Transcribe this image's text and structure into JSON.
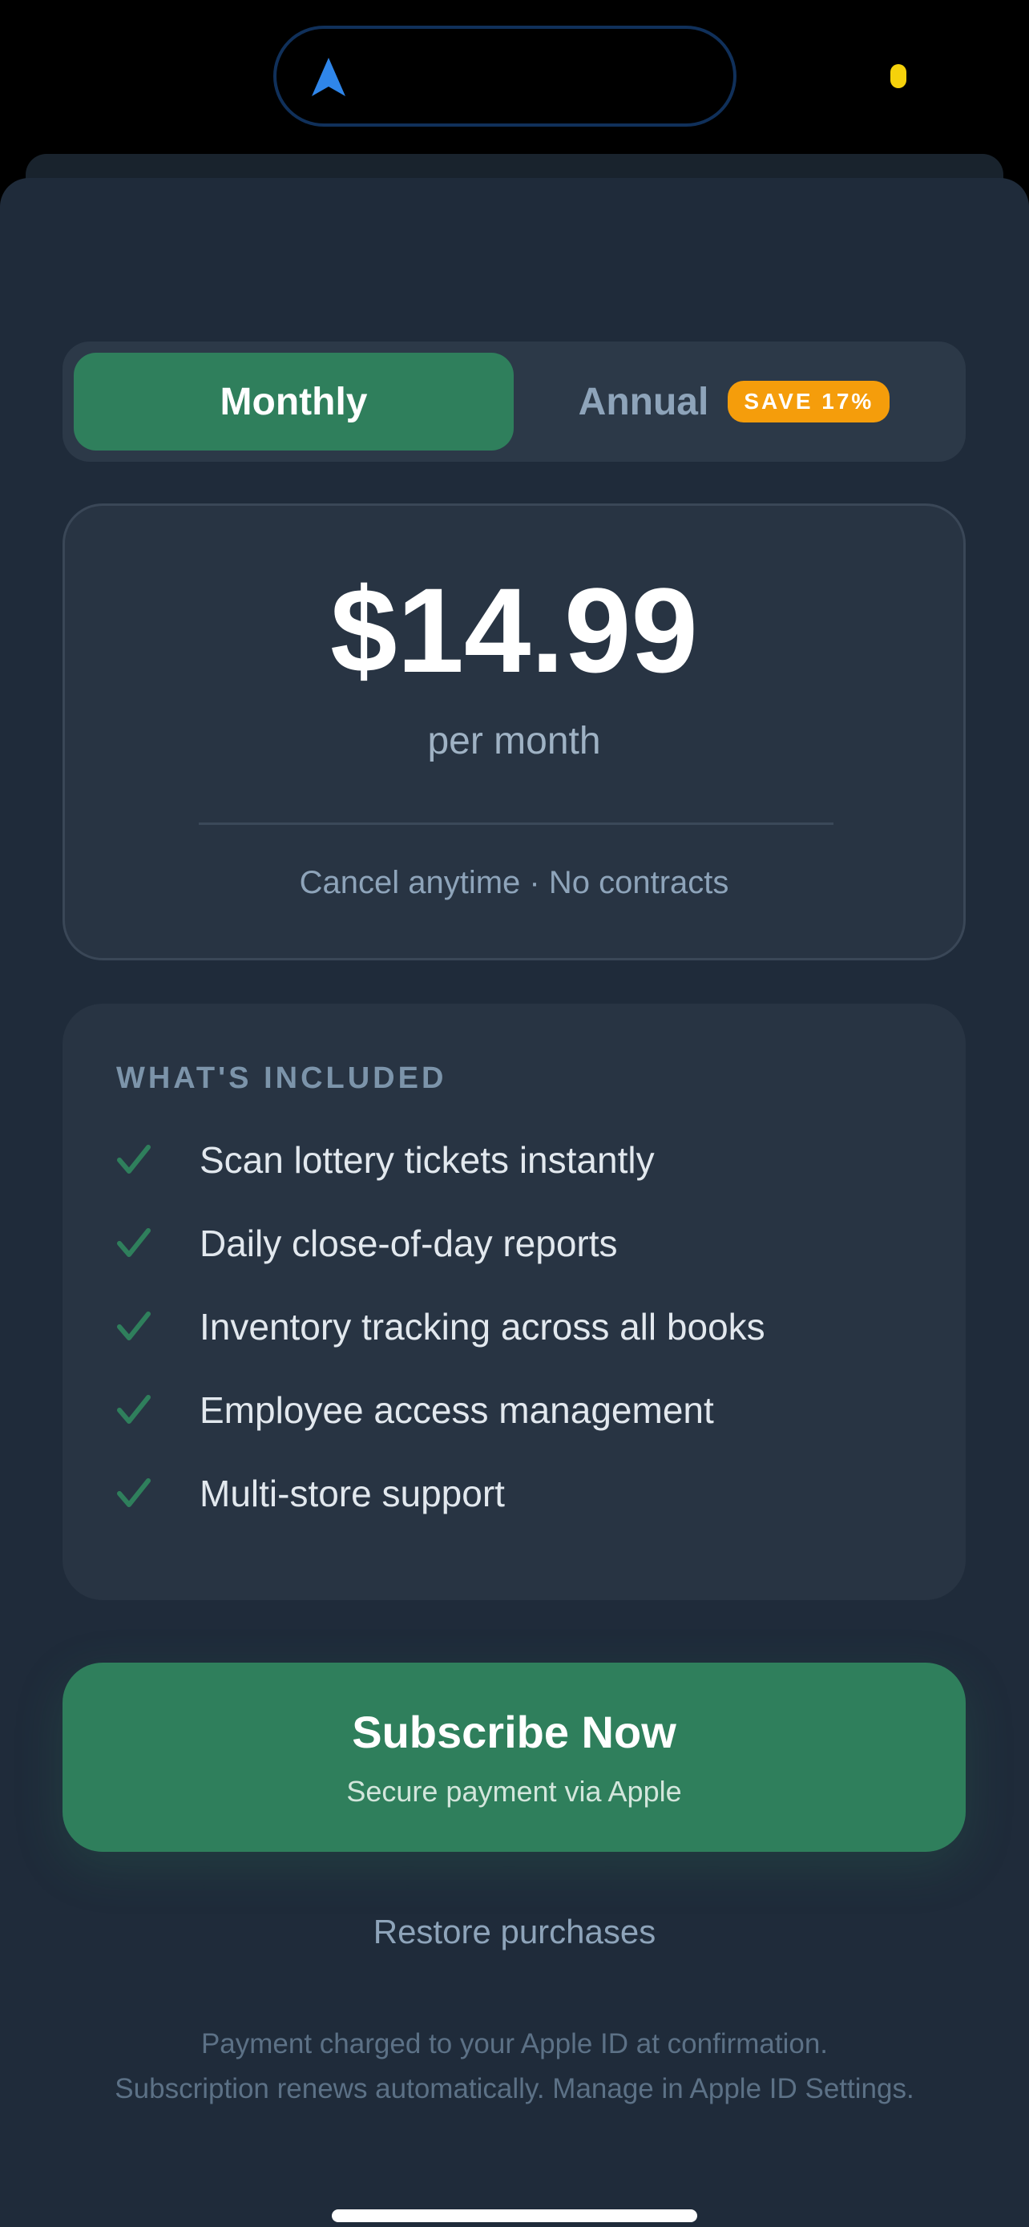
{
  "plan_toggle": {
    "monthly_label": "Monthly",
    "annual_label": "Annual",
    "annual_badge": "SAVE 17%",
    "selected": "Monthly"
  },
  "price_card": {
    "price": "$14.99",
    "period": "per month",
    "note": "Cancel anytime · No contracts"
  },
  "features": {
    "title": "WHAT'S INCLUDED",
    "items": [
      {
        "label": "Scan lottery tickets instantly",
        "icon": "check-icon"
      },
      {
        "label": "Daily close-of-day reports",
        "icon": "check-icon"
      },
      {
        "label": "Inventory tracking across all books",
        "icon": "check-icon"
      },
      {
        "label": "Employee access management",
        "icon": "check-icon"
      },
      {
        "label": "Multi-store support",
        "icon": "check-icon"
      }
    ]
  },
  "subscribe": {
    "label": "Subscribe Now",
    "sublabel": "Secure payment via Apple"
  },
  "restore_label": "Restore purchases",
  "legal": {
    "line1": "Payment charged to your Apple ID at confirmation.",
    "line2": "Subscription renews automatically. Manage in Apple ID Settings."
  },
  "colors": {
    "background": "#1f2b3a",
    "card": "#283443",
    "accent_green": "#2f7f5c",
    "badge_orange": "#f59d0b",
    "location_arrow": "#2f86ea"
  },
  "status_bar": {
    "icon": "location-arrow-icon"
  }
}
